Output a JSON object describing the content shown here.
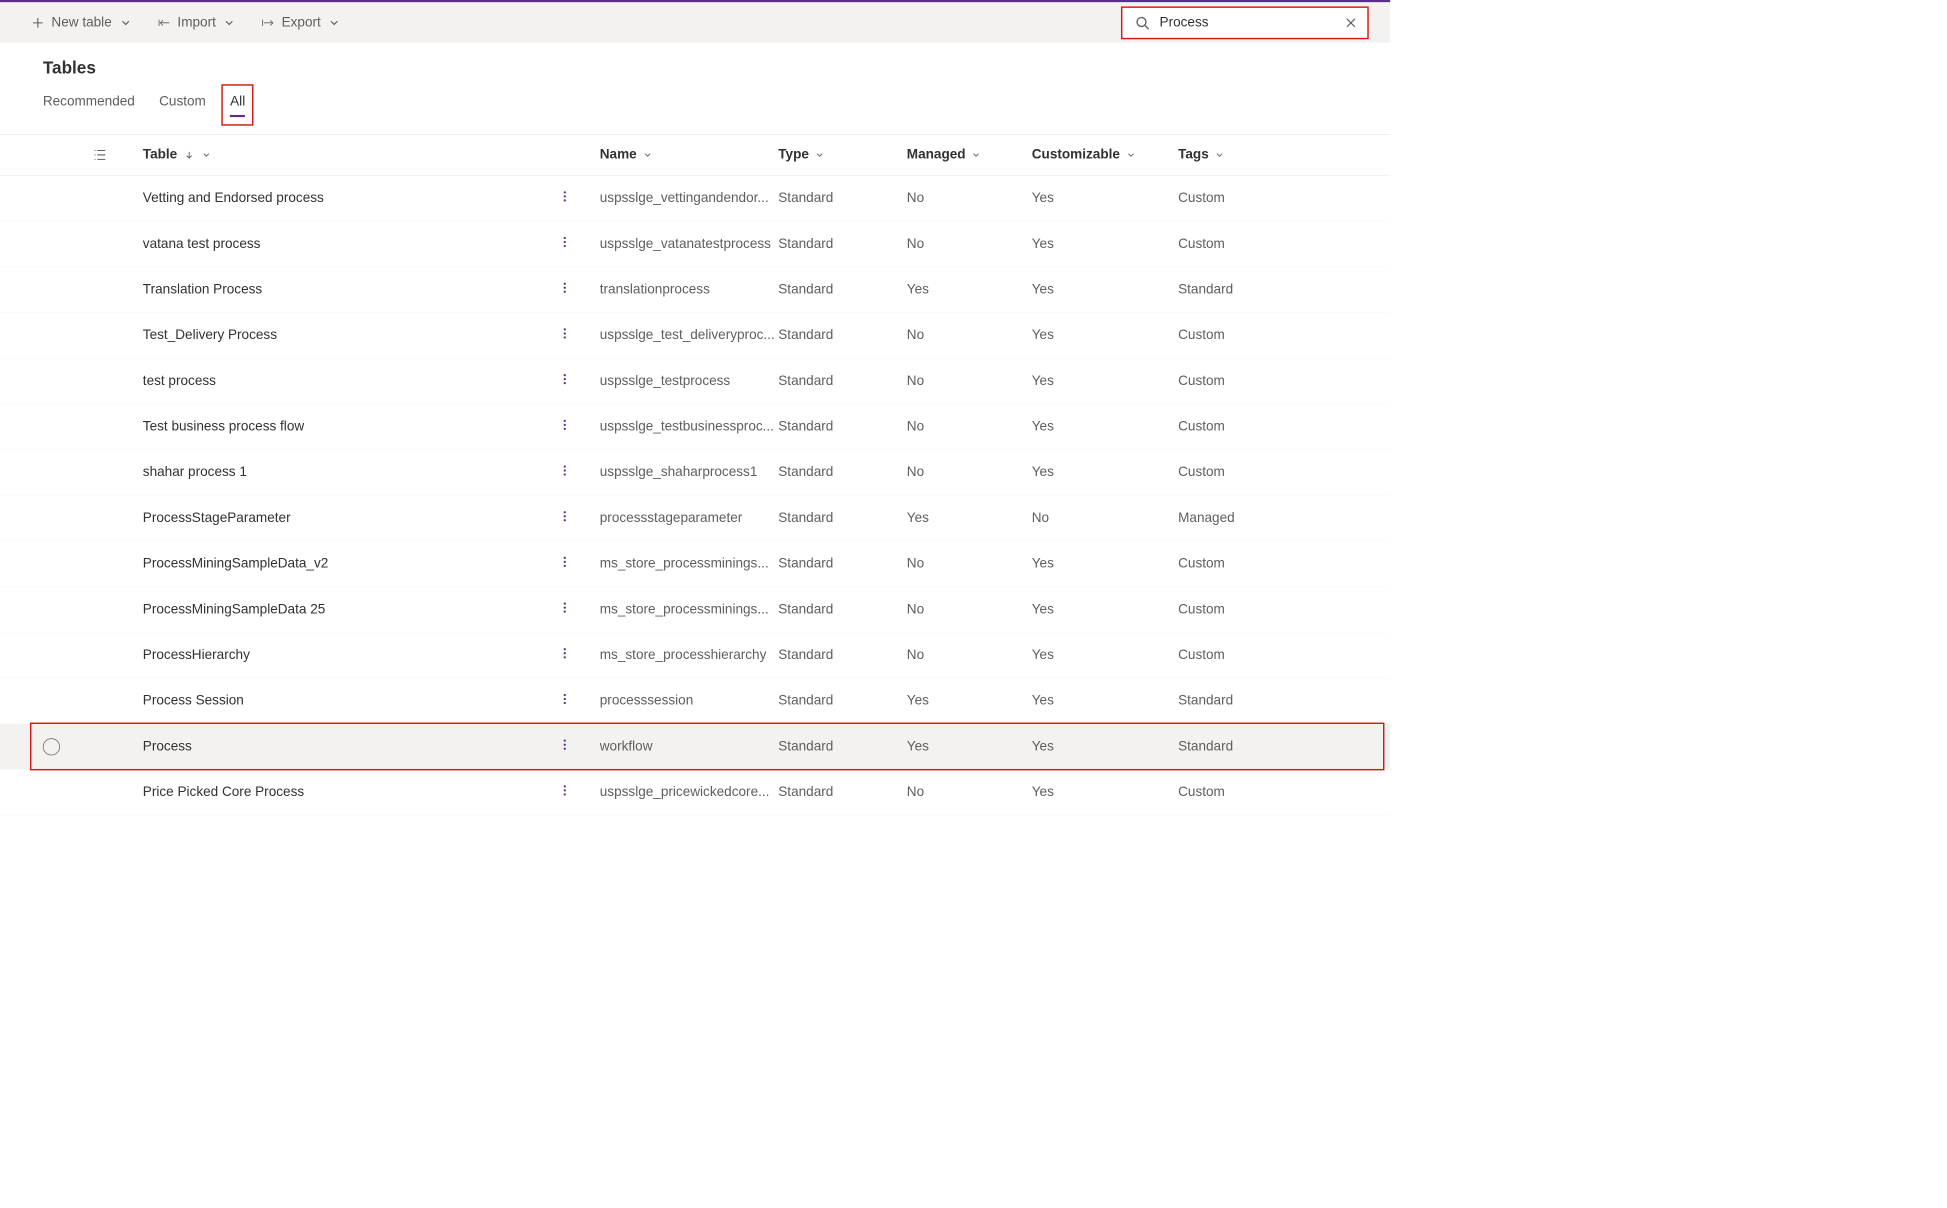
{
  "toolbar": {
    "new_table": "New table",
    "import": "Import",
    "export": "Export"
  },
  "search": {
    "value": "Process"
  },
  "page_title": "Tables",
  "tabs": {
    "recommended": "Recommended",
    "custom": "Custom",
    "all": "All"
  },
  "columns": {
    "table": "Table",
    "name": "Name",
    "type": "Type",
    "managed": "Managed",
    "customizable": "Customizable",
    "tags": "Tags"
  },
  "rows": [
    {
      "table": "Vetting and Endorsed process",
      "name": "uspsslge_vettingandendor...",
      "type": "Standard",
      "managed": "No",
      "customizable": "Yes",
      "tags": "Custom"
    },
    {
      "table": "vatana test process",
      "name": "uspsslge_vatanatestprocess",
      "type": "Standard",
      "managed": "No",
      "customizable": "Yes",
      "tags": "Custom"
    },
    {
      "table": "Translation Process",
      "name": "translationprocess",
      "type": "Standard",
      "managed": "Yes",
      "customizable": "Yes",
      "tags": "Standard"
    },
    {
      "table": "Test_Delivery Process",
      "name": "uspsslge_test_deliveryproc...",
      "type": "Standard",
      "managed": "No",
      "customizable": "Yes",
      "tags": "Custom"
    },
    {
      "table": "test process",
      "name": "uspsslge_testprocess",
      "type": "Standard",
      "managed": "No",
      "customizable": "Yes",
      "tags": "Custom"
    },
    {
      "table": "Test business process flow",
      "name": "uspsslge_testbusinessproc...",
      "type": "Standard",
      "managed": "No",
      "customizable": "Yes",
      "tags": "Custom"
    },
    {
      "table": "shahar process 1",
      "name": "uspsslge_shaharprocess1",
      "type": "Standard",
      "managed": "No",
      "customizable": "Yes",
      "tags": "Custom"
    },
    {
      "table": "ProcessStageParameter",
      "name": "processstageparameter",
      "type": "Standard",
      "managed": "Yes",
      "customizable": "No",
      "tags": "Managed"
    },
    {
      "table": "ProcessMiningSampleData_v2",
      "name": "ms_store_processminings...",
      "type": "Standard",
      "managed": "No",
      "customizable": "Yes",
      "tags": "Custom"
    },
    {
      "table": "ProcessMiningSampleData 25",
      "name": "ms_store_processminings...",
      "type": "Standard",
      "managed": "No",
      "customizable": "Yes",
      "tags": "Custom"
    },
    {
      "table": "ProcessHierarchy",
      "name": "ms_store_processhierarchy",
      "type": "Standard",
      "managed": "No",
      "customizable": "Yes",
      "tags": "Custom"
    },
    {
      "table": "Process Session",
      "name": "processsession",
      "type": "Standard",
      "managed": "Yes",
      "customizable": "Yes",
      "tags": "Standard"
    },
    {
      "table": "Process",
      "name": "workflow",
      "type": "Standard",
      "managed": "Yes",
      "customizable": "Yes",
      "tags": "Standard",
      "highlighted": true
    },
    {
      "table": "Price Picked Core Process",
      "name": "uspsslge_pricewickedcore...",
      "type": "Standard",
      "managed": "No",
      "customizable": "Yes",
      "tags": "Custom"
    }
  ]
}
